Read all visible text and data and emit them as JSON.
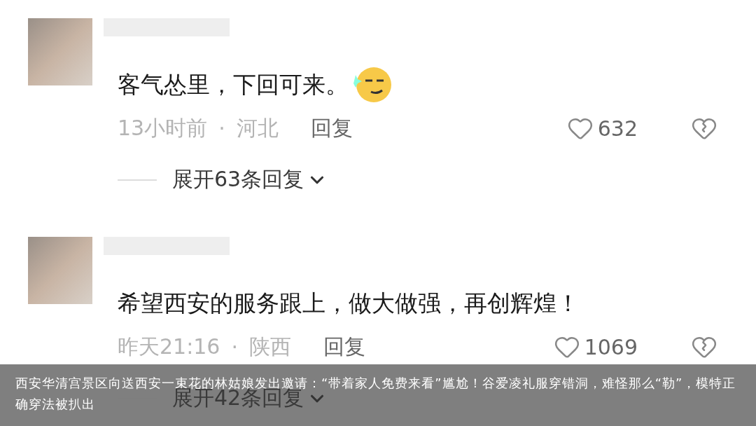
{
  "comments": [
    {
      "text": "客气怂里，下回可来。",
      "has_emoji": true,
      "time": "13小时前",
      "separator": "·",
      "location": "河北",
      "reply": "回复",
      "likes": "632",
      "expand": "展开63条回复"
    },
    {
      "text": "希望西安的服务跟上，做大做强，再创辉煌！",
      "has_emoji": false,
      "time": "昨天21:16",
      "separator": "·",
      "location": "陕西",
      "reply": "回复",
      "likes": "1069",
      "expand": "展开42条回复"
    }
  ],
  "caption": "西安华清宫景区向送西安一束花的林姑娘发出邀请：“带着家人免费来看”尴尬！谷爱凌礼服穿错洞，难怪那么“勒”，模特正确穿法被扒出"
}
